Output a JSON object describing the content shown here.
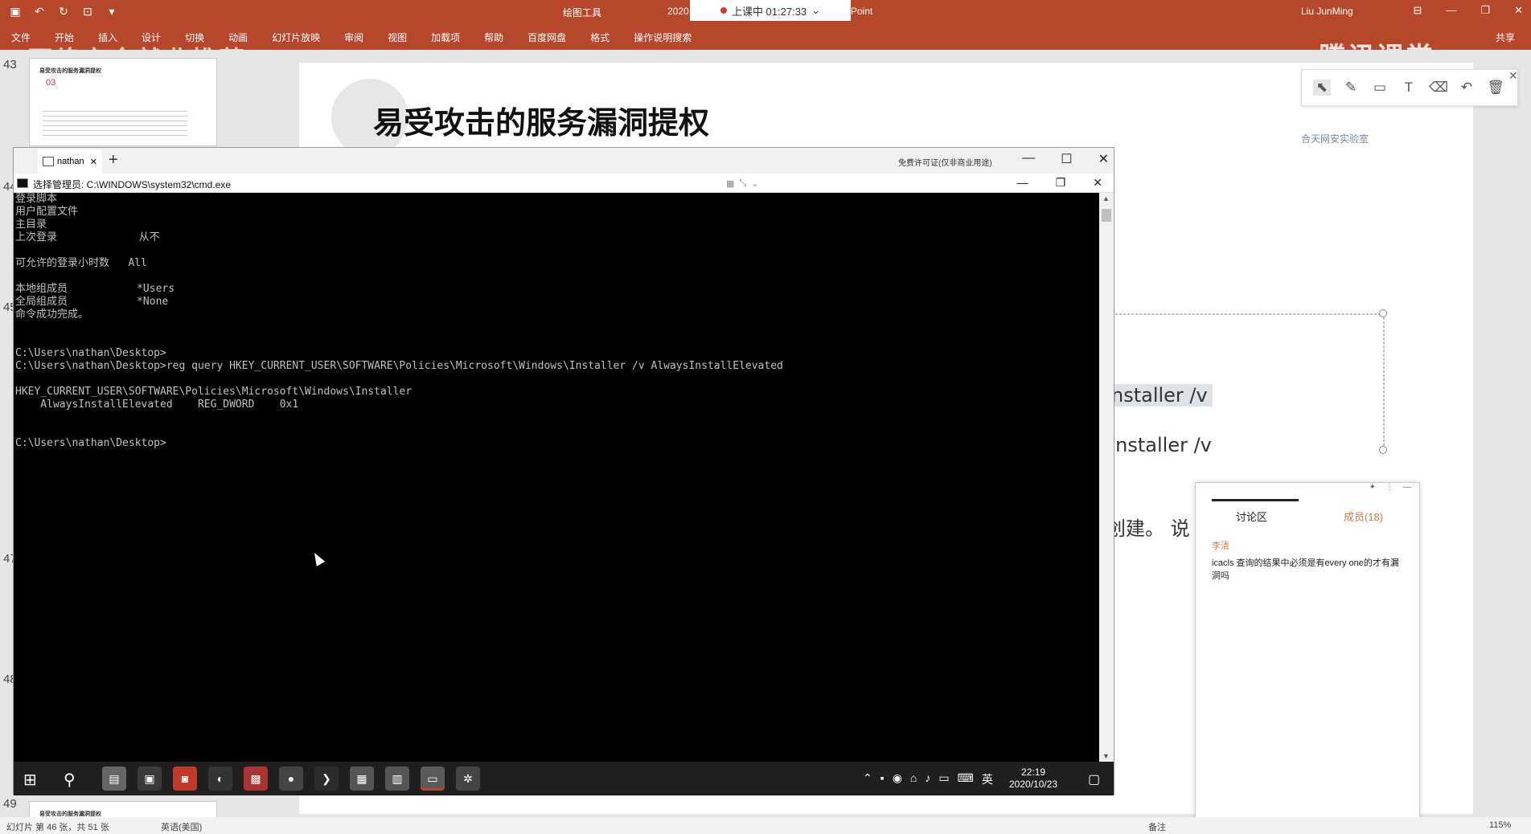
{
  "ppt": {
    "tools_label": "绘图工具",
    "title_part": "2020",
    "title_suffix": "Point",
    "user": "Liu JunMing",
    "class_timer": "上课中 01:27:33",
    "ribbon_tabs": [
      "文件",
      "开始",
      "插入",
      "设计",
      "切换",
      "动画",
      "幻灯片放映",
      "审阅",
      "视图",
      "加载项",
      "帮助",
      "百度网盘",
      "格式",
      "操作说明搜索"
    ],
    "share": "共享",
    "brand_logo": "腾讯课堂",
    "watermark": "网络安全就业推荐",
    "slide_numbers": [
      "43",
      "44",
      "45",
      "47",
      "48",
      "49"
    ],
    "thumb_title": "易受攻击的服务漏洞提权",
    "thumb_num": "03",
    "slide_title": "易受攻击的服务漏洞提权",
    "slide_brand": "合天网安实验室",
    "slide_text_1": "nstaller /v",
    "slide_text_2": "\\Installer /v",
    "slide_text_3": "创建。 说",
    "status_left": "幻灯片 第 46 张，共 51 张",
    "status_lang": "英语(美国)",
    "status_notes": "备注",
    "status_zoom": "115%"
  },
  "discussion": {
    "tab_discussion": "讨论区",
    "tab_members": "成员(18)",
    "user": "李清",
    "message": "icacls 查询的结果中必须是有every one的才有漏洞吗"
  },
  "terminal": {
    "tab_label": "nathan",
    "license_note": "免费许可证(仅非商业用途)",
    "cmd_title": "选择管理员: C:\\WINDOWS\\system32\\cmd.exe",
    "lines": [
      "登录脚本",
      "用户配置文件",
      "主目录",
      "上次登录             从不",
      "",
      "可允许的登录小时数   All",
      "",
      "本地组成员           *Users",
      "全局组成员           *None",
      "命令成功完成。",
      "",
      "",
      "C:\\Users\\nathan\\Desktop>",
      "C:\\Users\\nathan\\Desktop>reg query HKEY_CURRENT_USER\\SOFTWARE\\Policies\\Microsoft\\Windows\\Installer /v AlwaysInstallElevated",
      "",
      "HKEY_CURRENT_USER\\SOFTWARE\\Policies\\Microsoft\\Windows\\Installer",
      "    AlwaysInstallElevated    REG_DWORD    0x1",
      "",
      "",
      "C:\\Users\\nathan\\Desktop>"
    ]
  },
  "taskbar": {
    "time": "22:19",
    "date": "2020/10/23",
    "ime": "英"
  }
}
